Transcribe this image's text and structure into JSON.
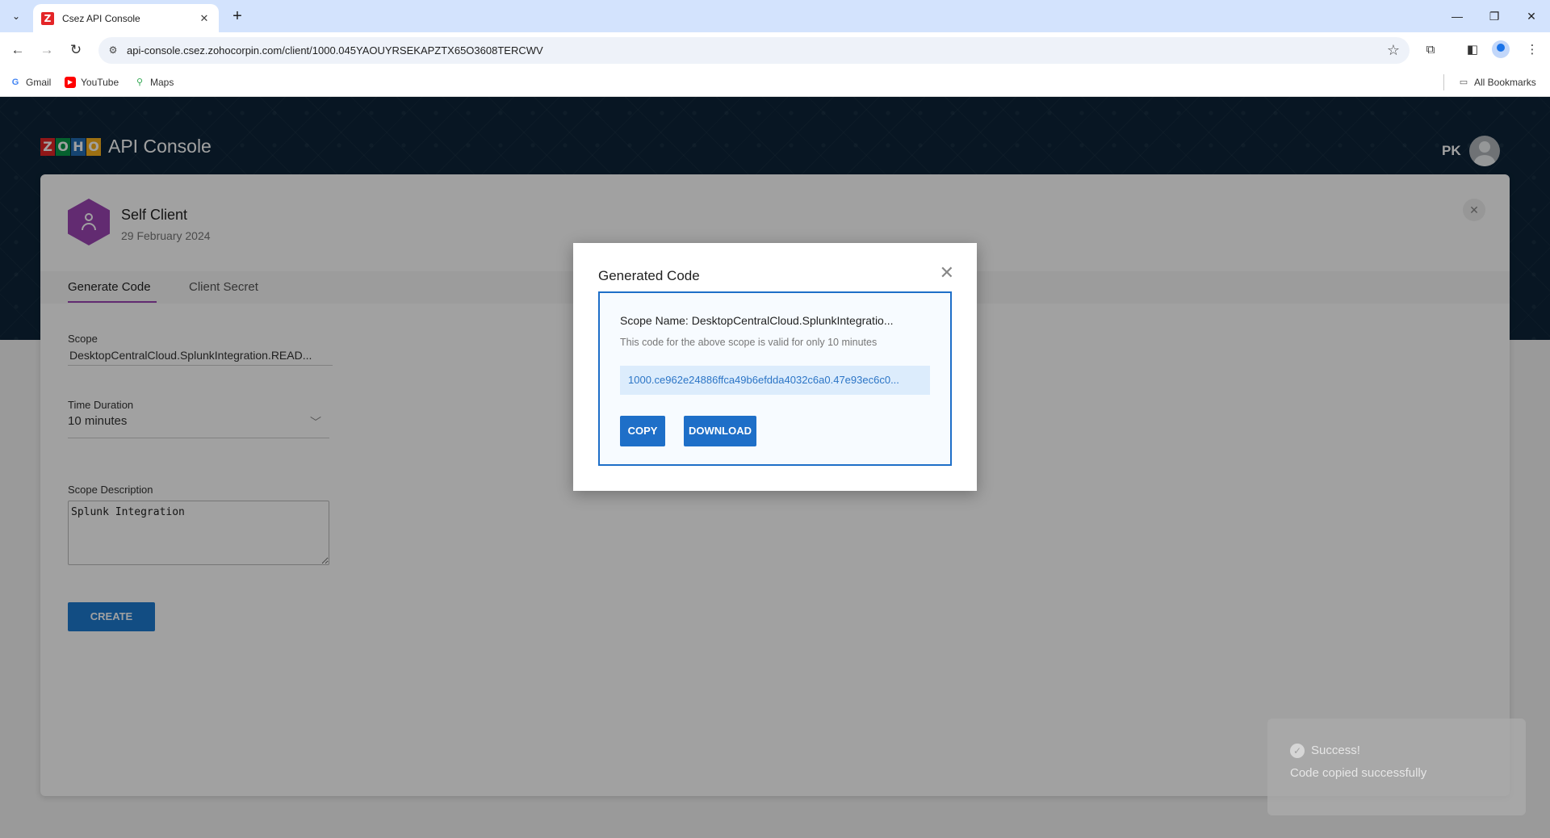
{
  "browser": {
    "tab_title": "Csez API Console",
    "favicon_letter": "Z",
    "url": "api-console.csez.zohocorpin.com/client/1000.045YAOUYRSEKAPZTX65O3608TERCWV",
    "bookmarks": [
      {
        "label": "Gmail",
        "icon": "google-icon",
        "color": "#4285f4"
      },
      {
        "label": "YouTube",
        "icon": "youtube-icon",
        "color": "#ff0000"
      },
      {
        "label": "Maps",
        "icon": "maps-pin-icon",
        "color": "#34a853"
      }
    ],
    "all_bookmarks_label": "All Bookmarks"
  },
  "header": {
    "logo_letters": [
      "Z",
      "O",
      "H",
      "O"
    ],
    "logo_colors": [
      "#e42527",
      "#089949",
      "#226db4",
      "#f9b21d"
    ],
    "title": "API Console",
    "user_initials": "PK"
  },
  "client": {
    "name": "Self Client",
    "date": "29 February 2024",
    "badge_color": "#9b44b4"
  },
  "tabs": [
    {
      "label": "Generate Code",
      "active": true
    },
    {
      "label": "Client Secret",
      "active": false
    }
  ],
  "form": {
    "scope_label": "Scope",
    "scope_value": "DesktopCentralCloud.SplunkIntegration.READ...",
    "duration_label": "Time Duration",
    "duration_value": "10 minutes",
    "description_label": "Scope Description",
    "description_value": "Splunk Integration",
    "create_label": "CREATE"
  },
  "modal": {
    "title": "Generated Code",
    "scope_name": "Scope Name: DesktopCentralCloud.SplunkIntegratio...",
    "valid_note": "This code for the above scope is valid for only 10 minutes",
    "code": "1000.ce962e24886ffca49b6efdda4032c6a0.47e93ec6c0...",
    "copy_label": "COPY",
    "download_label": "DOWNLOAD"
  },
  "toast": {
    "title": "Success!",
    "message": "Code copied successfully"
  },
  "colors": {
    "accent": "#1e6fc8",
    "hero_bg": "#0d2438",
    "tab_underline": "#9b44b4"
  }
}
